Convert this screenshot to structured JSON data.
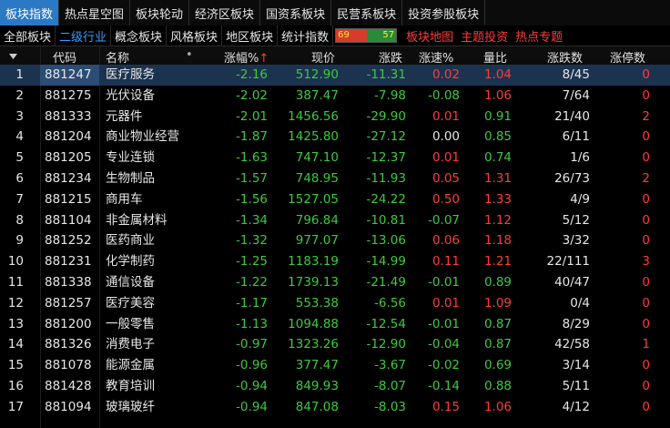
{
  "top_tabs": [
    "板块指数",
    "热点星空图",
    "板块轮动",
    "经济区板块",
    "国资系板块",
    "民营系板块",
    "投资参股板块"
  ],
  "sub_tabs": [
    "全部板块",
    "二级行业",
    "概念板块",
    "风格板块",
    "地区板块",
    "统计指数"
  ],
  "ratio": {
    "up": "69",
    "down": "57"
  },
  "red_links": [
    "板块地图",
    "主题投资",
    "热点专题"
  ],
  "columns": {
    "code": "代码",
    "name": "名称",
    "dot": "•",
    "pct": "涨幅%",
    "sort": "↑",
    "price": "现价",
    "change": "涨跌",
    "speed": "涨速%",
    "vol_ratio": "量比",
    "updown": "涨跌数",
    "limitup": "涨停数"
  },
  "colors": {
    "green": "#3ec93e",
    "red": "#ff3b3b",
    "white": "#e6e6e6",
    "yellow": "#ffd400"
  },
  "rows": [
    {
      "no": "1",
      "code": "881247",
      "name": "医疗服务",
      "pct": "-2.16",
      "price": "512.90",
      "change": "-11.31",
      "speed": "0.02",
      "speed_c": "red",
      "vr": "1.04",
      "vr_c": "red",
      "ud": "8/45",
      "lu": "0",
      "lu_c": "red"
    },
    {
      "no": "2",
      "code": "881275",
      "name": "光伏设备",
      "pct": "-2.02",
      "price": "387.47",
      "change": "-7.98",
      "speed": "-0.08",
      "speed_c": "green",
      "vr": "1.06",
      "vr_c": "red",
      "ud": "7/64",
      "lu": "0",
      "lu_c": "red"
    },
    {
      "no": "3",
      "code": "881333",
      "name": "元器件",
      "pct": "-2.01",
      "price": "1456.56",
      "change": "-29.90",
      "speed": "0.01",
      "speed_c": "red",
      "vr": "0.91",
      "vr_c": "green",
      "ud": "21/40",
      "lu": "2",
      "lu_c": "red"
    },
    {
      "no": "4",
      "code": "881204",
      "name": "商业物业经营",
      "pct": "-1.87",
      "price": "1425.80",
      "change": "-27.12",
      "speed": "0.00",
      "speed_c": "white",
      "vr": "0.85",
      "vr_c": "green",
      "ud": "6/11",
      "lu": "0",
      "lu_c": "red"
    },
    {
      "no": "5",
      "code": "881205",
      "name": "专业连锁",
      "pct": "-1.63",
      "price": "747.10",
      "change": "-12.37",
      "speed": "0.01",
      "speed_c": "red",
      "vr": "0.74",
      "vr_c": "green",
      "ud": "1/6",
      "lu": "0",
      "lu_c": "red"
    },
    {
      "no": "6",
      "code": "881234",
      "name": "生物制品",
      "pct": "-1.57",
      "price": "748.95",
      "change": "-11.93",
      "speed": "0.05",
      "speed_c": "red",
      "vr": "1.31",
      "vr_c": "red",
      "ud": "26/73",
      "lu": "2",
      "lu_c": "red"
    },
    {
      "no": "7",
      "code": "881215",
      "name": "商用车",
      "pct": "-1.56",
      "price": "1527.05",
      "change": "-24.22",
      "speed": "0.50",
      "speed_c": "red",
      "vr": "1.33",
      "vr_c": "red",
      "ud": "4/9",
      "lu": "0",
      "lu_c": "red"
    },
    {
      "no": "8",
      "code": "881104",
      "name": "非金属材料",
      "pct": "-1.34",
      "price": "796.84",
      "change": "-10.81",
      "speed": "-0.07",
      "speed_c": "green",
      "vr": "1.12",
      "vr_c": "red",
      "ud": "5/12",
      "lu": "0",
      "lu_c": "red"
    },
    {
      "no": "9",
      "code": "881252",
      "name": "医药商业",
      "pct": "-1.32",
      "price": "977.07",
      "change": "-13.06",
      "speed": "0.06",
      "speed_c": "red",
      "vr": "1.18",
      "vr_c": "red",
      "ud": "3/32",
      "lu": "0",
      "lu_c": "red"
    },
    {
      "no": "10",
      "code": "881231",
      "name": "化学制药",
      "pct": "-1.25",
      "price": "1183.19",
      "change": "-14.99",
      "speed": "0.11",
      "speed_c": "red",
      "vr": "1.21",
      "vr_c": "red",
      "ud": "22/111",
      "lu": "3",
      "lu_c": "red"
    },
    {
      "no": "11",
      "code": "881338",
      "name": "通信设备",
      "pct": "-1.22",
      "price": "1739.13",
      "change": "-21.49",
      "speed": "-0.01",
      "speed_c": "green",
      "vr": "0.89",
      "vr_c": "green",
      "ud": "40/47",
      "lu": "0",
      "lu_c": "red"
    },
    {
      "no": "12",
      "code": "881257",
      "name": "医疗美容",
      "pct": "-1.17",
      "price": "553.38",
      "change": "-6.56",
      "speed": "0.01",
      "speed_c": "red",
      "vr": "1.09",
      "vr_c": "red",
      "ud": "0/4",
      "lu": "0",
      "lu_c": "red"
    },
    {
      "no": "13",
      "code": "881200",
      "name": "一般零售",
      "pct": "-1.13",
      "price": "1094.88",
      "change": "-12.54",
      "speed": "-0.01",
      "speed_c": "green",
      "vr": "0.87",
      "vr_c": "green",
      "ud": "8/29",
      "lu": "0",
      "lu_c": "red"
    },
    {
      "no": "14",
      "code": "881326",
      "name": "消费电子",
      "pct": "-0.97",
      "price": "1323.26",
      "change": "-12.90",
      "speed": "-0.04",
      "speed_c": "green",
      "vr": "0.87",
      "vr_c": "green",
      "ud": "42/58",
      "lu": "1",
      "lu_c": "red"
    },
    {
      "no": "15",
      "code": "881078",
      "name": "能源金属",
      "pct": "-0.96",
      "price": "377.47",
      "change": "-3.67",
      "speed": "-0.02",
      "speed_c": "green",
      "vr": "0.69",
      "vr_c": "green",
      "ud": "3/14",
      "lu": "0",
      "lu_c": "red"
    },
    {
      "no": "16",
      "code": "881428",
      "name": "教育培训",
      "pct": "-0.94",
      "price": "849.93",
      "change": "-8.07",
      "speed": "-0.14",
      "speed_c": "green",
      "vr": "0.88",
      "vr_c": "green",
      "ud": "5/11",
      "lu": "0",
      "lu_c": "red"
    },
    {
      "no": "17",
      "code": "881094",
      "name": "玻璃玻纤",
      "pct": "-0.94",
      "price": "847.08",
      "change": "-8.03",
      "speed": "0.15",
      "speed_c": "red",
      "vr": "1.06",
      "vr_c": "red",
      "ud": "4/12",
      "lu": "0",
      "lu_c": "red"
    }
  ]
}
